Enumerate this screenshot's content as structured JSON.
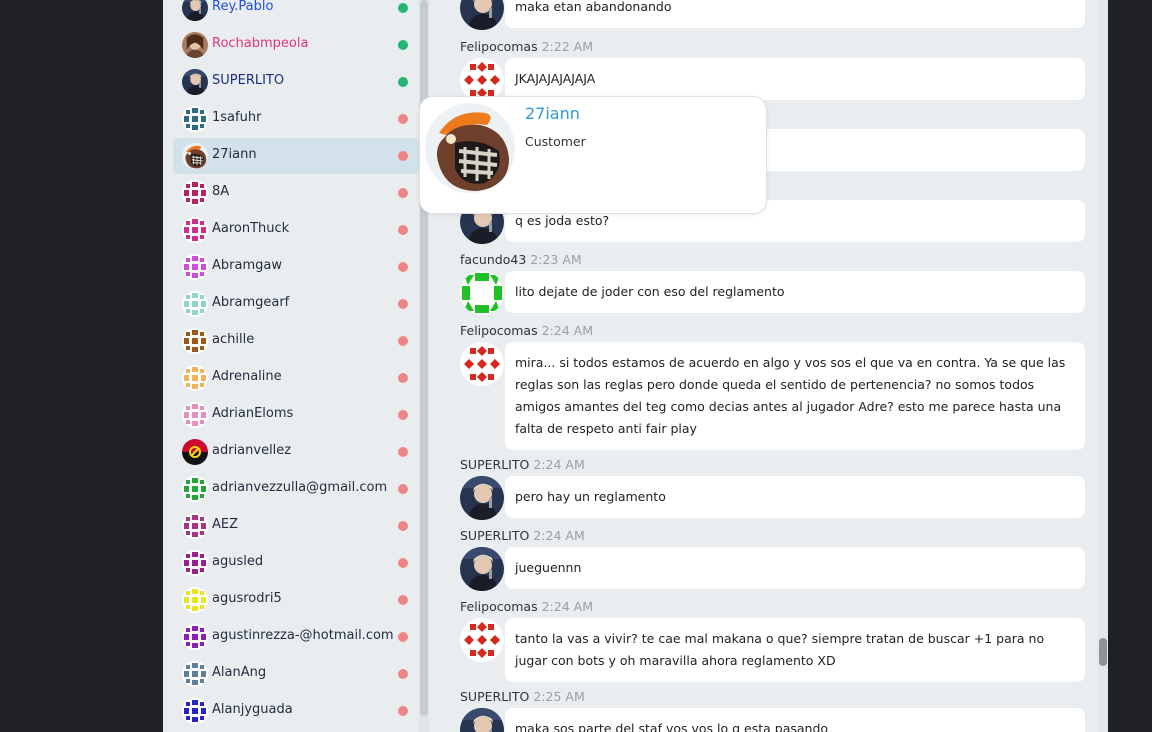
{
  "users": [
    {
      "name": "Rey.Pablo",
      "status": "online",
      "name_color": "#1f4fd6",
      "avatar": "photo-dark"
    },
    {
      "name": "Rochabmpeola",
      "status": "online",
      "name_color": "#e0357a",
      "avatar": "photo-brown"
    },
    {
      "name": "SUPERLITO",
      "status": "online",
      "name_color": "#1a2f7a",
      "avatar": "photo-dark"
    },
    {
      "name": "1safuhr",
      "status": "offline",
      "name_color": "#1f2d3d",
      "avatar": "identicon",
      "color": "#2d6b85"
    },
    {
      "name": "27iann",
      "status": "offline",
      "name_color": "#1f2d3d",
      "avatar": "cartoon",
      "selected": true
    },
    {
      "name": "8A",
      "status": "offline",
      "name_color": "#1f2d3d",
      "avatar": "identicon",
      "color": "#b5245d"
    },
    {
      "name": "AaronThuck",
      "status": "offline",
      "name_color": "#1f2d3d",
      "avatar": "identicon",
      "color": "#cc2f87"
    },
    {
      "name": "Abramgaw",
      "status": "offline",
      "name_color": "#1f2d3d",
      "avatar": "identicon",
      "color": "#d04fd8"
    },
    {
      "name": "Abramgearf",
      "status": "offline",
      "name_color": "#1f2d3d",
      "avatar": "identicon",
      "color": "#8ed6c7"
    },
    {
      "name": "achille",
      "status": "offline",
      "name_color": "#1f2d3d",
      "avatar": "identicon",
      "color": "#9a5a1c"
    },
    {
      "name": "Adrenaline",
      "status": "offline",
      "name_color": "#1f2d3d",
      "avatar": "identicon",
      "color": "#f0b35a"
    },
    {
      "name": "AdrianEloms",
      "status": "offline",
      "name_color": "#1f2d3d",
      "avatar": "identicon",
      "color": "#e58fc0"
    },
    {
      "name": "adrianvellez",
      "status": "offline",
      "name_color": "#1f2d3d",
      "avatar": "flag-angola"
    },
    {
      "name": "adrianvezzulla@gmail.com",
      "status": "offline",
      "name_color": "#1f2d3d",
      "avatar": "identicon",
      "color": "#22a63a"
    },
    {
      "name": "AEZ",
      "status": "offline",
      "name_color": "#1f2d3d",
      "avatar": "identicon",
      "color": "#a83480"
    },
    {
      "name": "agusled",
      "status": "offline",
      "name_color": "#1f2d3d",
      "avatar": "identicon",
      "color": "#9c1f8e"
    },
    {
      "name": "agusrodri5",
      "status": "offline",
      "name_color": "#1f2d3d",
      "avatar": "identicon",
      "color": "#e9e61e"
    },
    {
      "name": "agustinrezza-@hotmail.com",
      "status": "offline",
      "name_color": "#1f2d3d",
      "avatar": "identicon",
      "color": "#8a1fb8"
    },
    {
      "name": "AlanAng",
      "status": "offline",
      "name_color": "#1f2d3d",
      "avatar": "identicon",
      "color": "#5f7f96"
    },
    {
      "name": "Alanjyguada",
      "status": "offline",
      "name_color": "#1f2d3d",
      "avatar": "identicon",
      "color": "#2424c8"
    }
  ],
  "messages": [
    {
      "author": "",
      "time": "",
      "text": "maka etan abandonando",
      "avatar": "photo-dark"
    },
    {
      "author": "Felipocomas",
      "time": "2:22 AM",
      "text": "JKAJAJAJAJAJA",
      "avatar": "identicon-red"
    },
    {
      "author": "",
      "time": "",
      "text": "",
      "avatar": ""
    },
    {
      "author": "",
      "time": "",
      "text": "q es joda esto?",
      "avatar": "photo-dark"
    },
    {
      "author": "facundo43",
      "time": "2:23 AM",
      "text": "lito dejate de joder con eso del reglamento",
      "avatar": "identicon-green"
    },
    {
      "author": "Felipocomas",
      "time": "2:24 AM",
      "text": "mira... si todos estamos de acuerdo en algo y vos sos el que va en contra. Ya se que las reglas son las reglas pero donde queda el sentido de pertenencia? no somos todos amigos amantes del teg como decias antes al jugador Adre? esto me parece hasta una falta de respeto anti fair play",
      "avatar": "identicon-red"
    },
    {
      "author": "SUPERLITO",
      "time": "2:24 AM",
      "text": "pero hay un reglamento",
      "avatar": "photo-dark"
    },
    {
      "author": "SUPERLITO",
      "time": "2:24 AM",
      "text": "jueguennn",
      "avatar": "photo-dark"
    },
    {
      "author": "Felipocomas",
      "time": "2:24 AM",
      "text": "tanto la vas a vivir? te cae mal makana o que? siempre tratan de buscar +1 para no jugar con bots y oh maravilla ahora reglamento XD",
      "avatar": "identicon-red"
    },
    {
      "author": "SUPERLITO",
      "time": "2:25 AM",
      "text": "maka sos parte del staf vos vos lo q esta pasando",
      "avatar": "photo-dark"
    }
  ],
  "popup": {
    "name": "27iann",
    "role": "Customer"
  }
}
